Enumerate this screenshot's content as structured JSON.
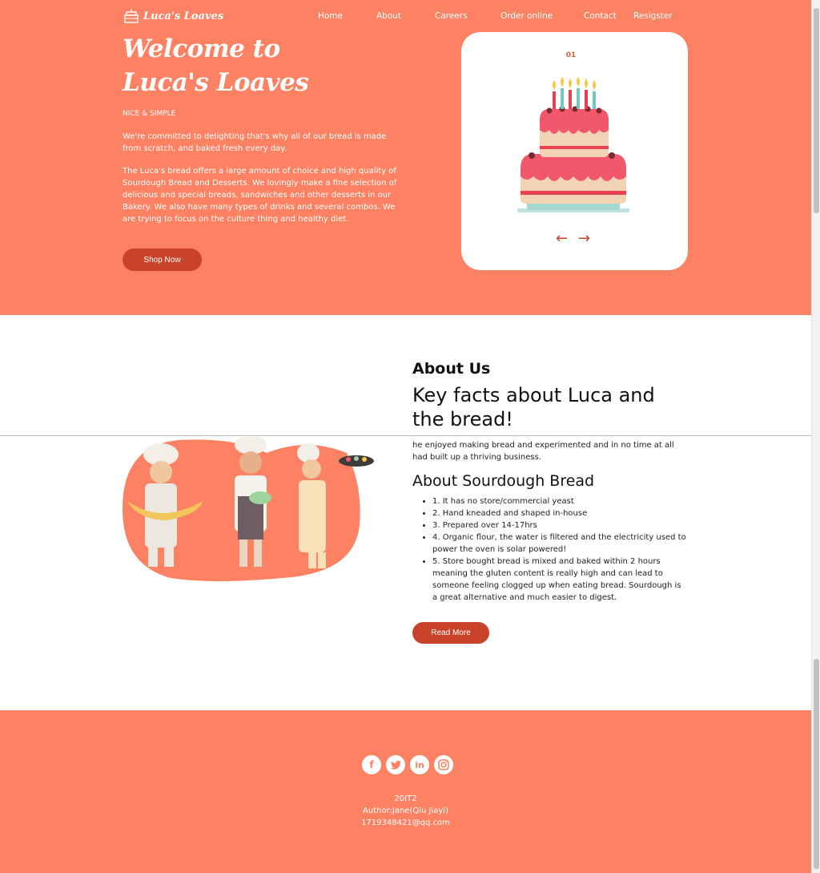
{
  "brand": {
    "name": "Luca's Loaves"
  },
  "nav": {
    "items": [
      "Home",
      "About",
      "Careers",
      "Order online",
      "Contact",
      "Resigster"
    ]
  },
  "hero": {
    "title_line1": "Welcome to",
    "title_line2": "Luca's Loaves",
    "tagline": "NICE & SIMPLE",
    "para1": "We're committed to delighting that's why all of our bread is made from scratch, and baked fresh every day.",
    "para2": "The Luca's bread offers a large amount of choice and high quality of Sourdough Bread and Desserts. We lovingly make a fine selection of delicious and special breads, sandwiches and other desserts in our Bakery. We also have many types of drinks and several combos. We are trying to focus on the culture thing and healthy diet.",
    "shop_label": "Shop Now",
    "slide_number": "01",
    "prev_arrow": "←",
    "next_arrow": "→"
  },
  "about": {
    "heading": "About Us",
    "subheading": "Key facts about Luca and the bread!",
    "clip_text": "he enjoyed making bread and experimented and in no time at all had built up a thriving business.",
    "sourdough_heading": "About Sourdough Bread",
    "facts": [
      "1. It has no store/commercial yeast",
      "2. Hand kneaded and shaped in-house",
      "3. Prepared over 14-17hrs",
      "4. Organic flour, the water is filtered and the electricity used to power the oven is solar powered!",
      "5. Store bought bread is mixed and baked within 2 hours meaning the gluten content is really high and can lead to someone feeling clogged up when eating bread. Sourdough is a great alternative and much easier to digest."
    ],
    "read_more_label": "Read More"
  },
  "footer": {
    "socials": [
      "facebook-icon",
      "twitter-icon",
      "linkedin-icon",
      "instagram-icon"
    ],
    "class_name": "20IT2",
    "author": "Author:Jane(Qiu Jiayi)",
    "email": "1719348421@qq.com"
  },
  "colors": {
    "primary": "#fc8263",
    "accent": "#c9432a",
    "white": "#ffffff"
  }
}
